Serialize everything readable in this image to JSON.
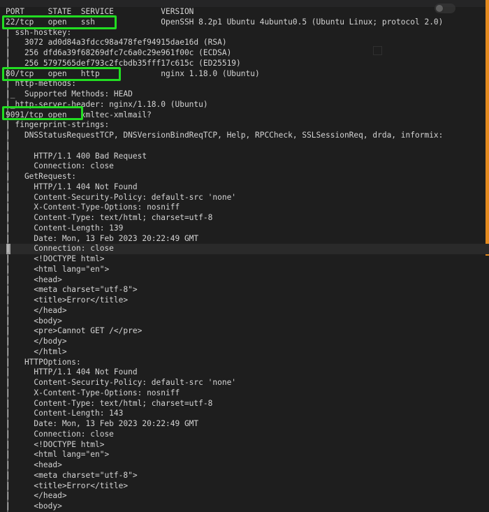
{
  "terminal": {
    "lines": [
      "PORT     STATE  SERVICE          VERSION",
      "22/tcp   open   ssh              OpenSSH 8.2p1 Ubuntu 4ubuntu0.5 (Ubuntu Linux; protocol 2.0)",
      "| ssh-hostkey: ",
      "|   3072 ad0d84a3fdcc98a478fef94915dae16d (RSA)",
      "|   256 dfd6a39f68269dfc7c6a0c29e961f00c (ECDSA)",
      "|_  256 5797565def793c2fcbdb35fff17c615c (ED25519)",
      "80/tcp   open   http             nginx 1.18.0 (Ubuntu)",
      "| http-methods: ",
      "|_  Supported Methods: HEAD",
      "|_http-server-header: nginx/1.18.0 (Ubuntu)",
      "9091/tcp open   xmltec-xmlmail?",
      "| fingerprint-strings: ",
      "|   DNSStatusRequestTCP, DNSVersionBindReqTCP, Help, RPCCheck, SSLSessionReq, drda, informix:",
      "|",
      "|     HTTP/1.1 400 Bad Request",
      "|     Connection: close",
      "|   GetRequest: ",
      "|     HTTP/1.1 404 Not Found",
      "|     Content-Security-Policy: default-src 'none'",
      "|     X-Content-Type-Options: nosniff",
      "|     Content-Type: text/html; charset=utf-8",
      "|     Content-Length: 139",
      "|     Date: Mon, 13 Feb 2023 20:22:49 GMT",
      "|     Connection: close",
      "|     <!DOCTYPE html>",
      "|     <html lang=\"en\">",
      "|     <head>",
      "|     <meta charset=\"utf-8\">",
      "|     <title>Error</title>",
      "|     </head>",
      "|     <body>",
      "|     <pre>Cannot GET /</pre>",
      "|     </body>",
      "|     </html>",
      "|   HTTPOptions: ",
      "|     HTTP/1.1 404 Not Found",
      "|     Content-Security-Policy: default-src 'none'",
      "|     X-Content-Type-Options: nosniff",
      "|     Content-Type: text/html; charset=utf-8",
      "|     Content-Length: 143",
      "|     Date: Mon, 13 Feb 2023 20:22:49 GMT",
      "|     Connection: close",
      "|     <!DOCTYPE html>",
      "|     <html lang=\"en\">",
      "|     <head>",
      "|     <meta charset=\"utf-8\">",
      "|     <title>Error</title>",
      "|     </head>",
      "|     <body>"
    ],
    "highlighted_line_index": 23,
    "highlighted_ports": [
      "22/tcp",
      "80/tcp",
      "9091/tcp"
    ]
  },
  "colors": {
    "background": "#1e1e1e",
    "text": "#d4d4d4",
    "highlight_box": "#22dd22",
    "accent_bar": "#e48a1f"
  }
}
